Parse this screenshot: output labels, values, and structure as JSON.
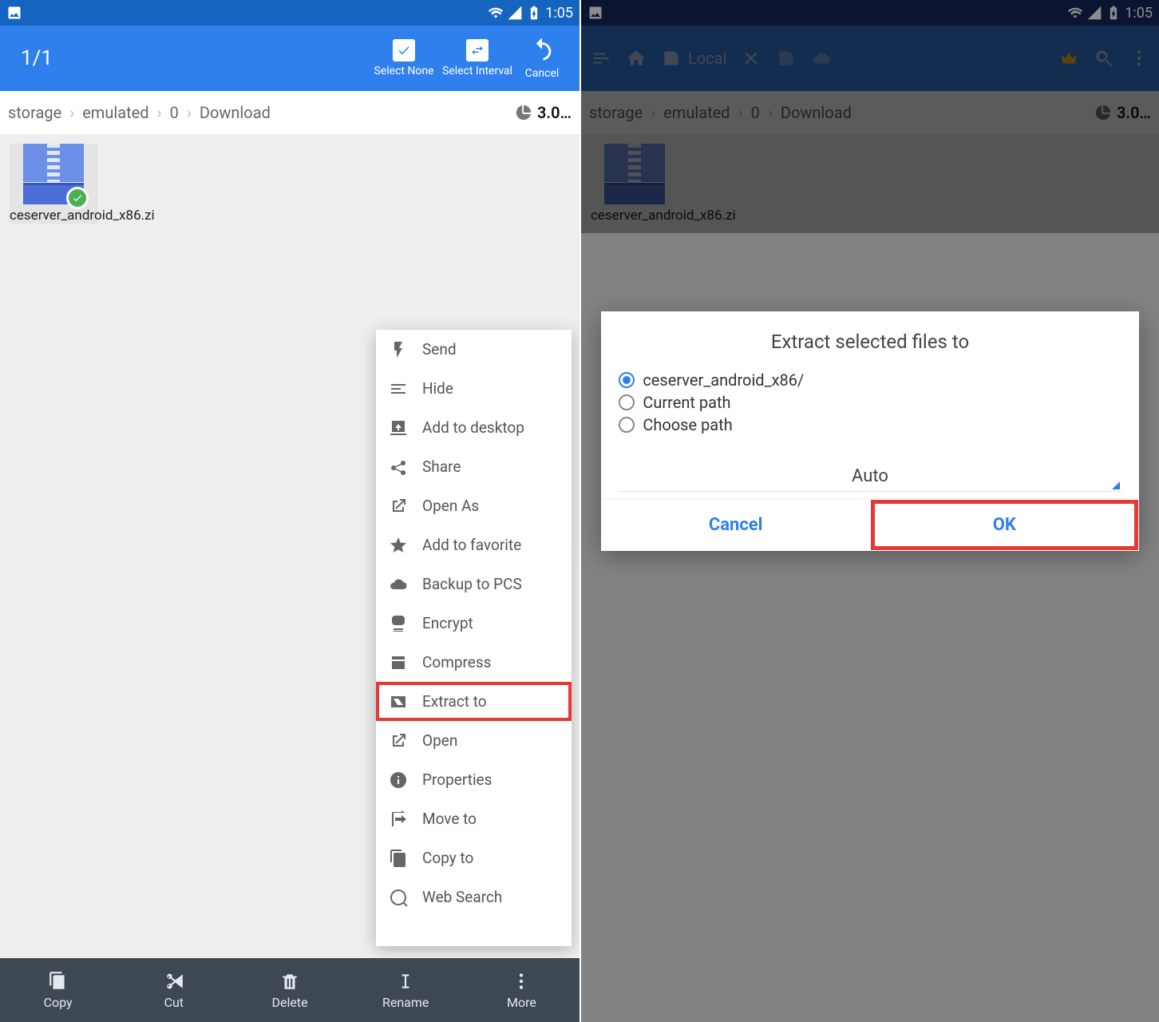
{
  "statusbar": {
    "time": "1:05"
  },
  "left": {
    "header": {
      "counter": "1/1",
      "select_none": "Select None",
      "select_interval": "Select Interval",
      "cancel": "Cancel"
    },
    "breadcrumb": [
      "storage",
      "emulated",
      "0",
      "Download"
    ],
    "storage_free": "3.0…",
    "file": {
      "name": "ceserver_android_x86.zi"
    },
    "context_menu": [
      "Send",
      "Hide",
      "Add to desktop",
      "Share",
      "Open As",
      "Add to favorite",
      "Backup to PCS",
      "Encrypt",
      "Compress",
      "Extract to",
      "Open",
      "Properties",
      "Move to",
      "Copy to",
      "Web Search"
    ],
    "context_highlight_index": 9,
    "bottombar": [
      "Copy",
      "Cut",
      "Delete",
      "Rename",
      "More"
    ]
  },
  "right": {
    "header": {
      "local_label": "Local"
    },
    "breadcrumb": [
      "storage",
      "emulated",
      "0",
      "Download"
    ],
    "storage_free": "3.0…",
    "file": {
      "name": "ceserver_android_x86.zi"
    },
    "dialog": {
      "title": "Extract selected files to",
      "options": [
        "ceserver_android_x86/",
        "Current path",
        "Choose path"
      ],
      "selected_option_index": 0,
      "encoding": "Auto",
      "cancel": "Cancel",
      "ok": "OK"
    }
  }
}
